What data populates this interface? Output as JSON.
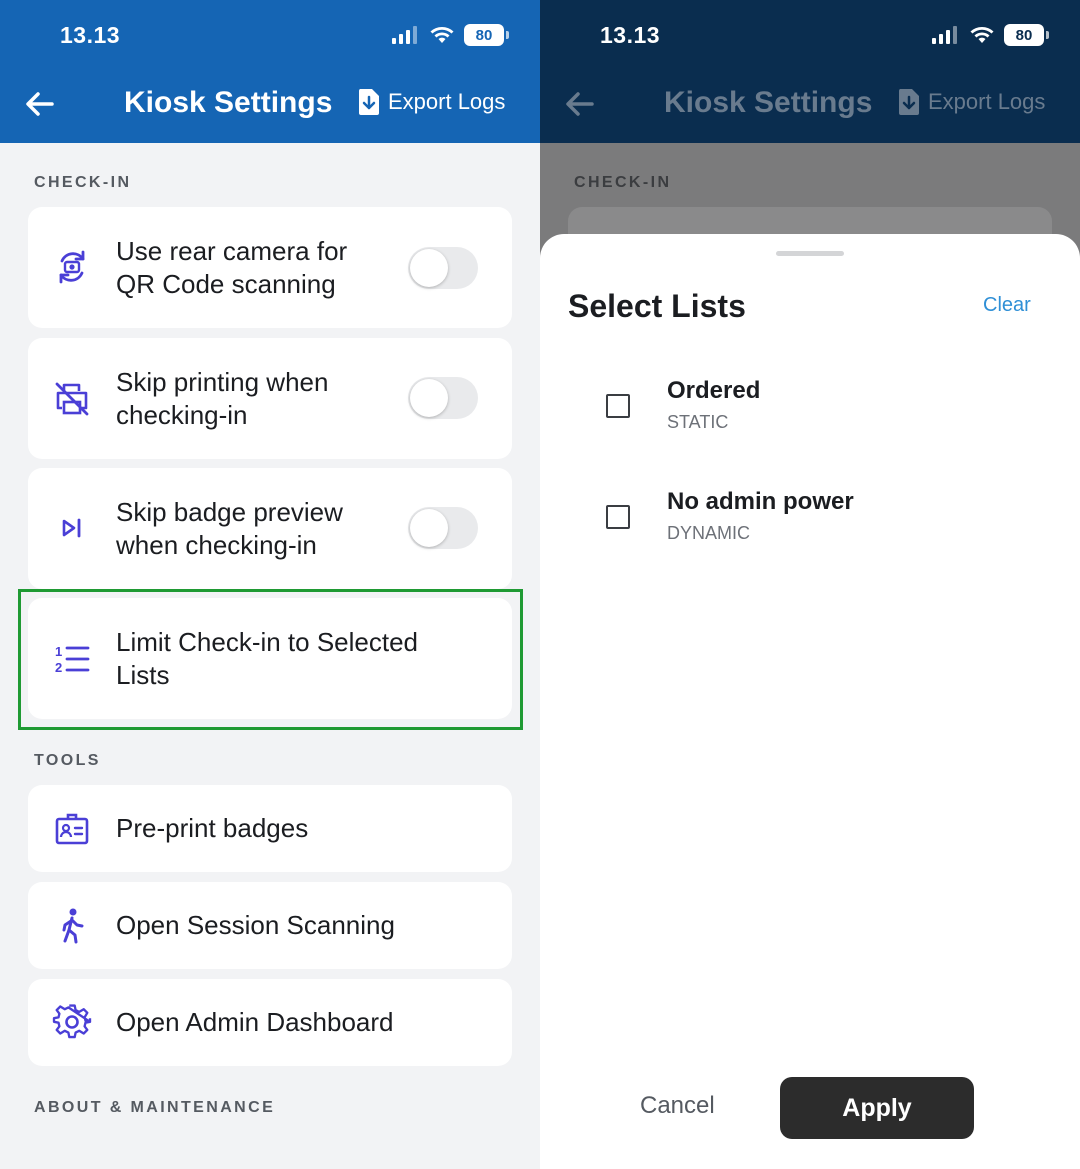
{
  "status": {
    "time": "13.13",
    "battery": "80"
  },
  "header": {
    "title": "Kiosk Settings",
    "export_label": "Export Logs"
  },
  "sections": {
    "check_in": "CHECK-IN",
    "tools": "TOOLS",
    "about": "ABOUT & MAINTENANCE"
  },
  "check_in_items": [
    {
      "label_line1": "Use rear camera for",
      "label_line2": "QR Code scanning",
      "icon": "camera-switch-icon",
      "toggle": false
    },
    {
      "label_line1": "Skip printing when",
      "label_line2": "checking-in",
      "icon": "printer-off-icon",
      "toggle": false
    },
    {
      "label_line1": "Skip badge preview",
      "label_line2": "when checking-in",
      "icon": "skip-next-icon",
      "toggle": false
    },
    {
      "label_line1": "Limit Check-in to Selected",
      "label_line2": "Lists",
      "icon": "numbered-list-icon"
    }
  ],
  "tools_items": [
    {
      "label": "Pre-print badges",
      "icon": "badge-icon"
    },
    {
      "label": "Open Session Scanning",
      "icon": "walking-person-icon"
    },
    {
      "label": "Open Admin Dashboard",
      "icon": "gear-icon"
    }
  ],
  "sheet": {
    "title": "Select Lists",
    "clear_label": "Clear",
    "lists": [
      {
        "name": "Ordered",
        "type": "STATIC",
        "checked": false
      },
      {
        "name": "No admin power",
        "type": "DYNAMIC",
        "checked": false
      }
    ],
    "cancel_label": "Cancel",
    "apply_label": "Apply"
  },
  "colors": {
    "brand": "#1565b4",
    "accent_icon": "#4a3fd6",
    "highlight": "#1f9a33",
    "link": "#2f8fd6"
  }
}
